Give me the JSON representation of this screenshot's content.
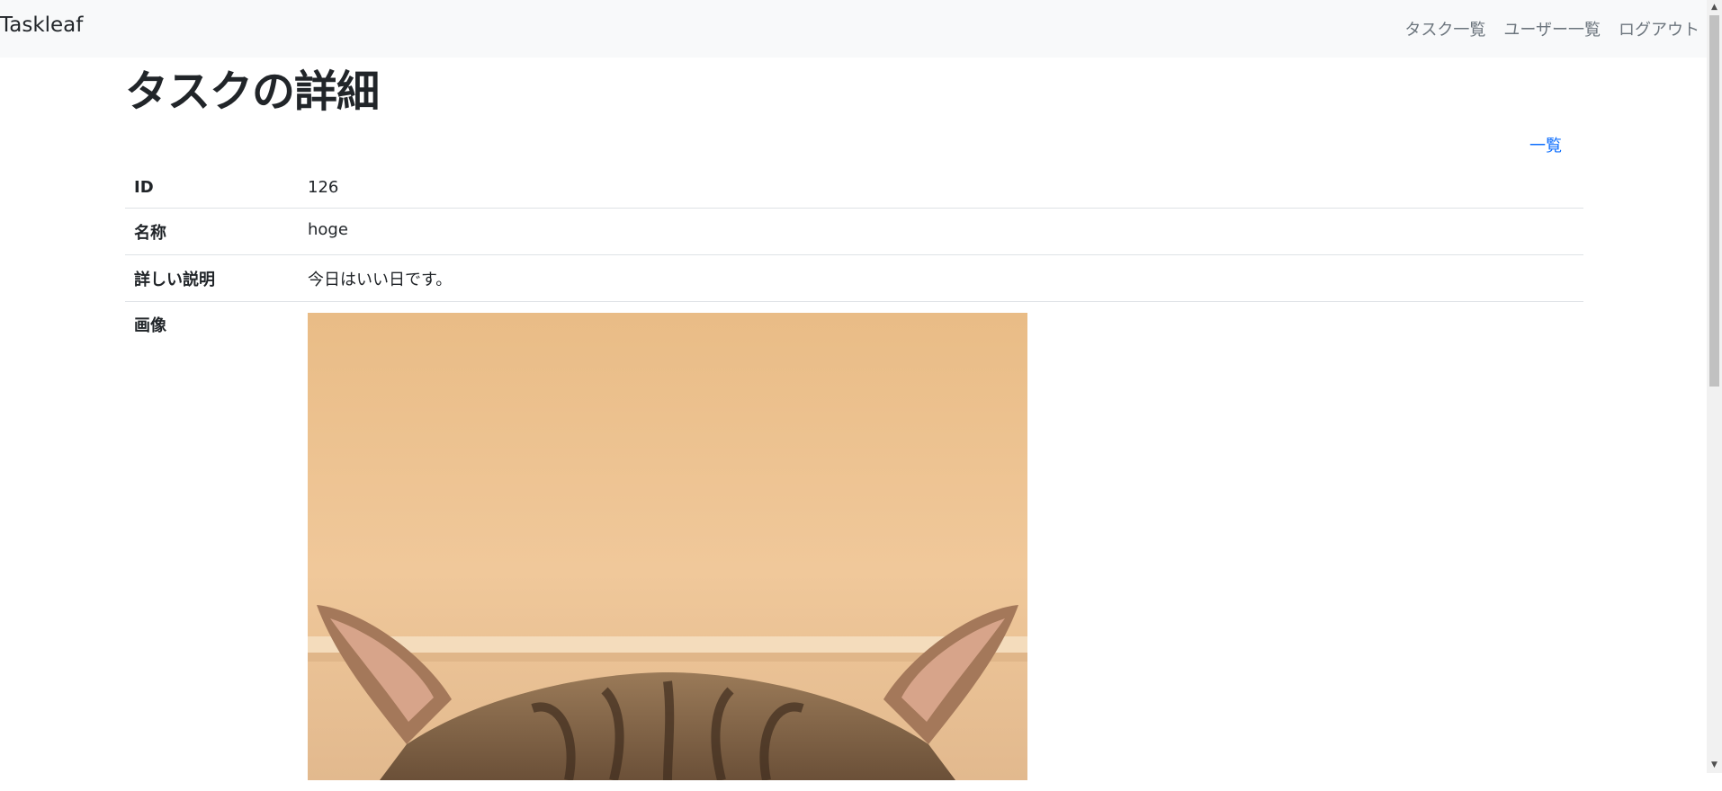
{
  "navbar": {
    "brand": "Taskleaf",
    "links": [
      "タスク一覧",
      "ユーザー一覧",
      "ログアウト"
    ]
  },
  "page": {
    "title": "タスクの詳細",
    "back_link": "一覧"
  },
  "details": [
    {
      "label": "ID",
      "value": "126"
    },
    {
      "label": "名称",
      "value": "hoge"
    },
    {
      "label": "詳しい説明",
      "value": "今日はいい日です。"
    },
    {
      "label": "画像",
      "value": ""
    }
  ],
  "colors": {
    "link": "#0d6efd",
    "navbar_bg": "#f8f9fa",
    "nav_link": "#6c757d"
  }
}
